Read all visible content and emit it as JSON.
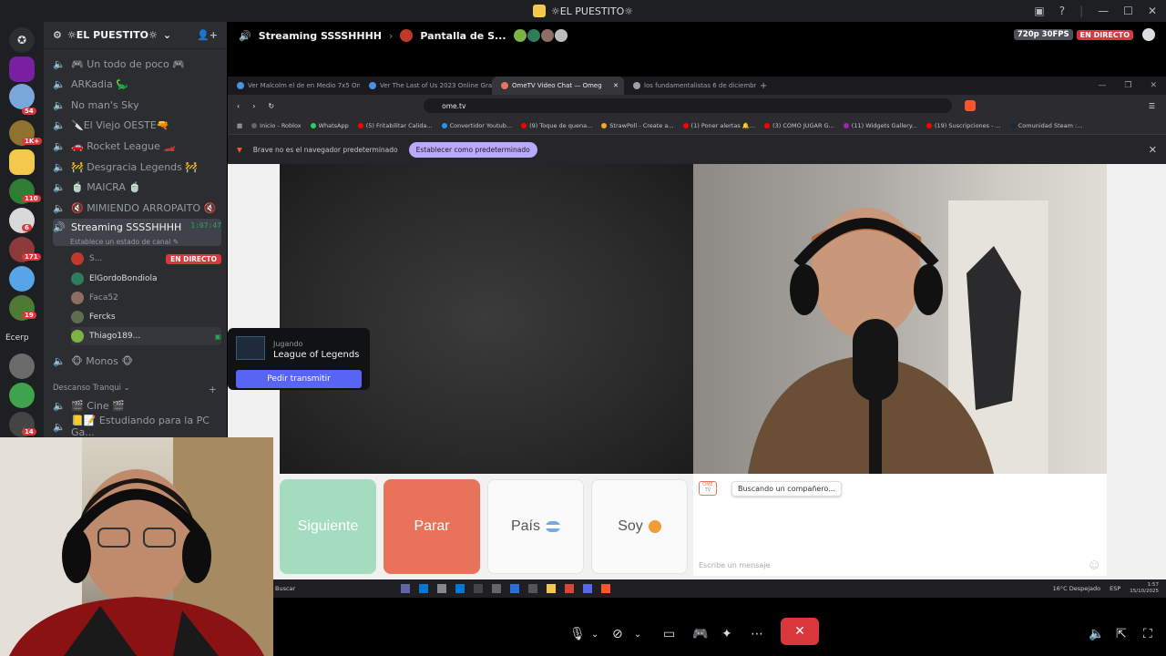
{
  "window": {
    "title": "☼EL PUESTITO☼"
  },
  "server": {
    "name": "☼EL PUESTITO☼"
  },
  "rail": {
    "servers": [
      {
        "name": "MEGA BONK"
      },
      {
        "name": "server-2",
        "badge": "54"
      },
      {
        "name": "server-3",
        "badge": "1K+"
      },
      {
        "name": "EL PUESTITO"
      },
      {
        "name": "server-5",
        "badge": "110"
      },
      {
        "name": "server-6",
        "badge": "6"
      },
      {
        "name": "server-7",
        "badge": "171"
      },
      {
        "name": "server-8"
      },
      {
        "name": "server-9",
        "badge": "19"
      },
      {
        "name": "Ecerp"
      },
      {
        "name": "server-11"
      },
      {
        "name": "server-12"
      },
      {
        "name": "server-13",
        "badge": "14"
      }
    ],
    "ecerp_label": "Ecerp"
  },
  "channels": [
    {
      "name": "🎮 Un todo de poco 🎮"
    },
    {
      "name": "ARKadia 🦕"
    },
    {
      "name": "No man's Sky"
    },
    {
      "name": "🔪El Viejo OESTE🔫"
    },
    {
      "name": "🚗 Rocket League 🏎️"
    },
    {
      "name": "🚧 Desgracia Legends 🚧"
    },
    {
      "name": "🍵 MAICRA 🍵"
    },
    {
      "name": "🔇 MIMIENDO ARROPAITO 🔇"
    }
  ],
  "active_channel": {
    "name": "Streaming SSSSHHHH",
    "timer": "1:07:47",
    "status_hint": "Establece un estado de canal ✎"
  },
  "members": [
    {
      "name": "S...",
      "live": "EN DIRECTO"
    },
    {
      "name": "ElGordoBondiola"
    },
    {
      "name": "Faca52"
    },
    {
      "name": "Fercks"
    },
    {
      "name": "Thiago189..."
    }
  ],
  "channel_after": {
    "name": "🐵 Monos 🐵"
  },
  "category": {
    "name": "Descanso Tranqui ⌄"
  },
  "category_channels": [
    {
      "name": "🎬 Cine 🎬"
    },
    {
      "name": "📒📝 Estudiando para la PC Ga..."
    }
  ],
  "streambar": {
    "channel": "Streaming SSSSHHHH",
    "screen": "Pantalla de S...",
    "quality": "720p 30FPS",
    "live": "EN DIRECTO"
  },
  "browser": {
    "tabs": [
      {
        "title": "Ver Malcolm el de en Medio 7x5 On"
      },
      {
        "title": "Ver The Last of Us 2023 Online Grati"
      },
      {
        "title": "OmeTV Video Chat — Omeg"
      },
      {
        "title": "los fundamentalistas 6 de diciembre"
      }
    ],
    "url": "ome.tv",
    "bookmarks": [
      "Inicio - Roblox",
      "WhatsApp",
      "(5) Fritabilitar Calida...",
      "Convertidor Youtub...",
      "(9) Toque de quena...",
      "StrawPoll - Create a...",
      "(1) Poner alertas 🔔...",
      "(3) COMO JUGAR G...",
      "(11) Widgets Gallery...",
      "(19) Suscripciones - ...",
      "Comunidad Steam :..."
    ],
    "infobar_text": "Brave no es el navegador predeterminado",
    "set_default": "Establecer como predeterminado"
  },
  "ometv": {
    "next": "Siguiente",
    "stop": "Parar",
    "country": "País",
    "i_am": "Soy",
    "searching": "Buscando un compañero...",
    "message_placeholder": "Escribe un mensaje",
    "logo": "OME TV"
  },
  "win_taskbar": {
    "search": "Buscar",
    "weather": "16°C Despejado",
    "lang": "ESP",
    "time": "1:57",
    "date": "15/10/2025"
  },
  "popup": {
    "playing_label": "Jugando",
    "game": "League of Legends",
    "request_button": "Pedir transmitir"
  }
}
